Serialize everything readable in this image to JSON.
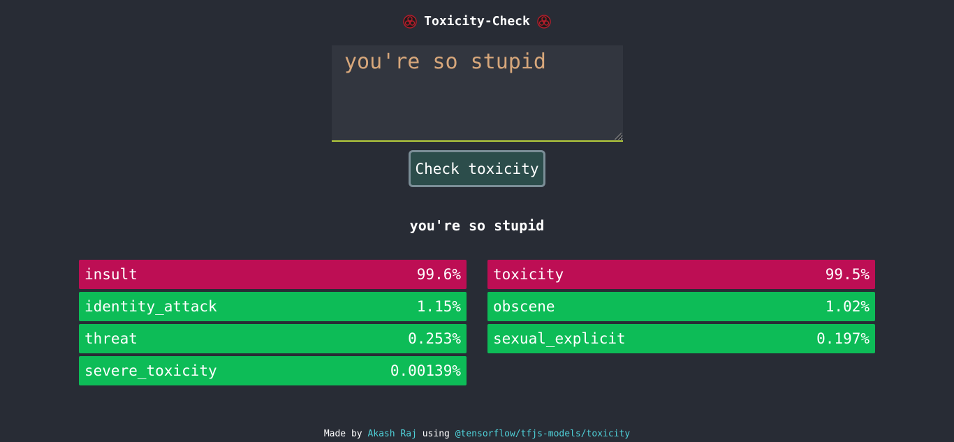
{
  "header": {
    "title": "Toxicity-Check",
    "left_icon": "hazard-icon",
    "right_icon": "hazard-icon",
    "icon_color": "#b31d2b"
  },
  "input": {
    "value": "you're so stupid",
    "placeholder": ""
  },
  "button": {
    "label": "Check toxicity"
  },
  "analyzed_text": "you're so stupid",
  "results": {
    "left": [
      {
        "label": "insult",
        "value": "99.6%",
        "status": "toxic"
      },
      {
        "label": "identity_attack",
        "value": "1.15%",
        "status": "safe"
      },
      {
        "label": "threat",
        "value": "0.253%",
        "status": "safe"
      },
      {
        "label": "severe_toxicity",
        "value": "0.00139%",
        "status": "safe"
      }
    ],
    "right": [
      {
        "label": "toxicity",
        "value": "99.5%",
        "status": "toxic"
      },
      {
        "label": "obscene",
        "value": "1.02%",
        "status": "safe"
      },
      {
        "label": "sexual_explicit",
        "value": "0.197%",
        "status": "safe"
      }
    ]
  },
  "colors": {
    "background": "#282c35",
    "toxic": "#bd0e54",
    "safe": "#0dbc57",
    "link": "#4fd1d9",
    "input_text": "#d7a77b"
  },
  "footer": {
    "made_by": "Made by",
    "author": "Akash Raj",
    "using": "using",
    "library": "@tensorflow/tfjs-models/toxicity"
  }
}
